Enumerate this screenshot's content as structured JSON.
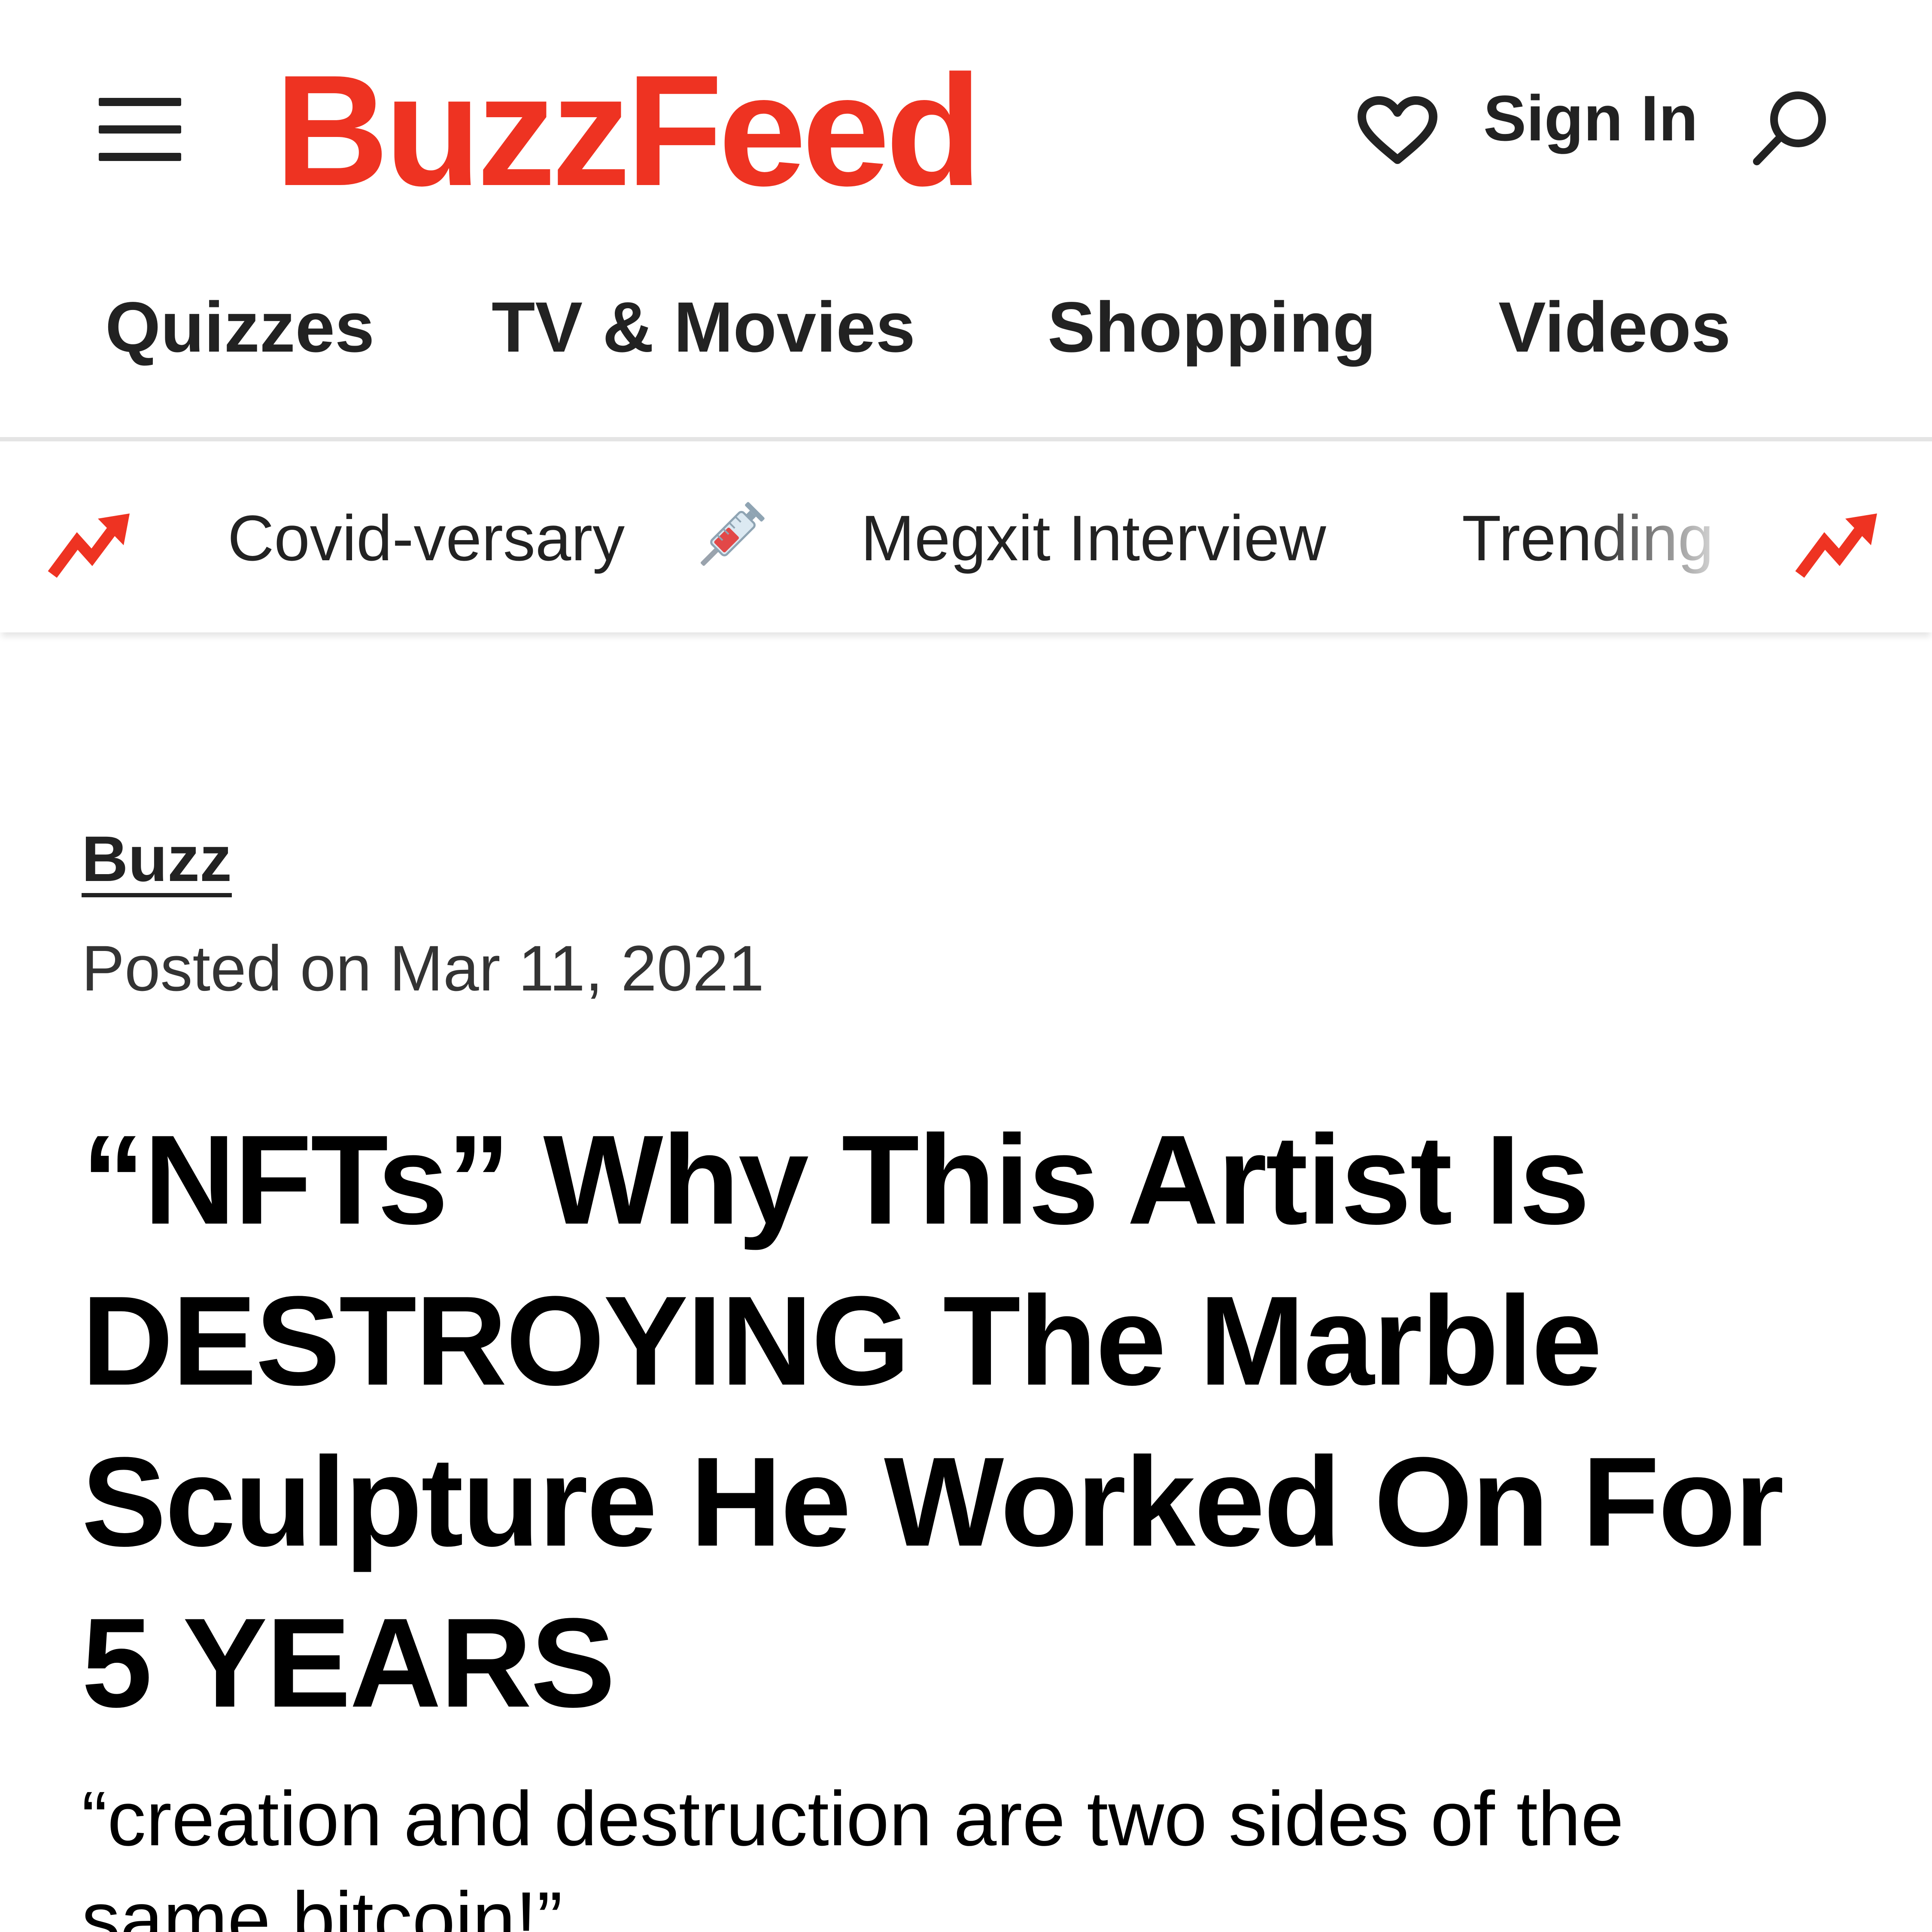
{
  "header": {
    "logo_text": "BuzzFeed",
    "signin_label": "Sign In"
  },
  "nav": {
    "items": [
      {
        "label": "Quizzes"
      },
      {
        "label": "TV & Movies"
      },
      {
        "label": "Shopping"
      },
      {
        "label": "Videos"
      }
    ]
  },
  "trending": {
    "items": [
      {
        "label": "Covid-versary",
        "emoji": "syringe-icon"
      },
      {
        "label": "Megxit Interview"
      },
      {
        "label": "Trending"
      }
    ],
    "icon": "trending-arrow-icon"
  },
  "article": {
    "category": "Buzz",
    "posted": "Posted on Mar 11, 2021",
    "headline": "“NFTs” Why This Artist Is DESTROYING The Marble Sculpture He Worked On For 5 YEARS",
    "dek": "“creation and destruction are two sides of the same bitcoin!”"
  },
  "colors": {
    "brand_red": "#ee3322",
    "text_dark": "#222222",
    "divider": "#e4e4e4"
  }
}
